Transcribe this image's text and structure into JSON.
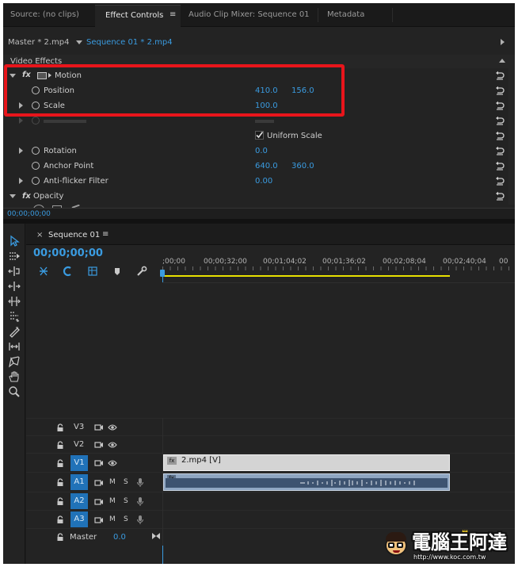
{
  "tabs": [
    {
      "label": "Source: (no clips)"
    },
    {
      "label": "Effect Controls"
    },
    {
      "label": "Audio Clip Mixer: Sequence 01"
    },
    {
      "label": "Metadata"
    }
  ],
  "effect_controls": {
    "master_label": "Master * 2.mp4",
    "sequence_label": "Sequence 01 * 2.mp4",
    "section_title": "Video Effects",
    "motion": {
      "label": "Motion",
      "position_label": "Position",
      "position_x": "410.0",
      "position_y": "156.0",
      "scale_label": "Scale",
      "scale_value": "100.0",
      "uniform_scale_label": "Uniform Scale",
      "rotation_label": "Rotation",
      "rotation_value": "0.0",
      "anchor_label": "Anchor Point",
      "anchor_x": "640.0",
      "anchor_y": "360.0",
      "antiflicker_label": "Anti-flicker Filter",
      "antiflicker_value": "0.00"
    },
    "opacity_label": "Opacity",
    "timecode": "00;00;00;00"
  },
  "timeline": {
    "sequence_tab": "Sequence 01",
    "timecode": "00;00;00;00",
    "ruler": [
      ";00;00",
      "00;00;32;00",
      "00;01;04;02",
      "00;01;36;02",
      "00;02;08;04",
      "00;02;40;04",
      "00"
    ],
    "tracks": {
      "v3": "V3",
      "v2": "V2",
      "v1": "V1",
      "a1": "A1",
      "a2": "A2",
      "a3": "A3"
    },
    "m_label": "M",
    "s_label": "S",
    "master_label": "Master",
    "master_value": "0.0",
    "video_clip": "2.mp4 [V]"
  },
  "watermark": {
    "site_name": "電腦王阿達",
    "url": "http://www.koc.com.tw"
  },
  "colors": {
    "accent_blue": "#3a9be0",
    "highlight_red": "#e8151b",
    "panel_bg": "#1d1d1d",
    "track_button": "#2072b8",
    "work_area": "#e8e000"
  }
}
